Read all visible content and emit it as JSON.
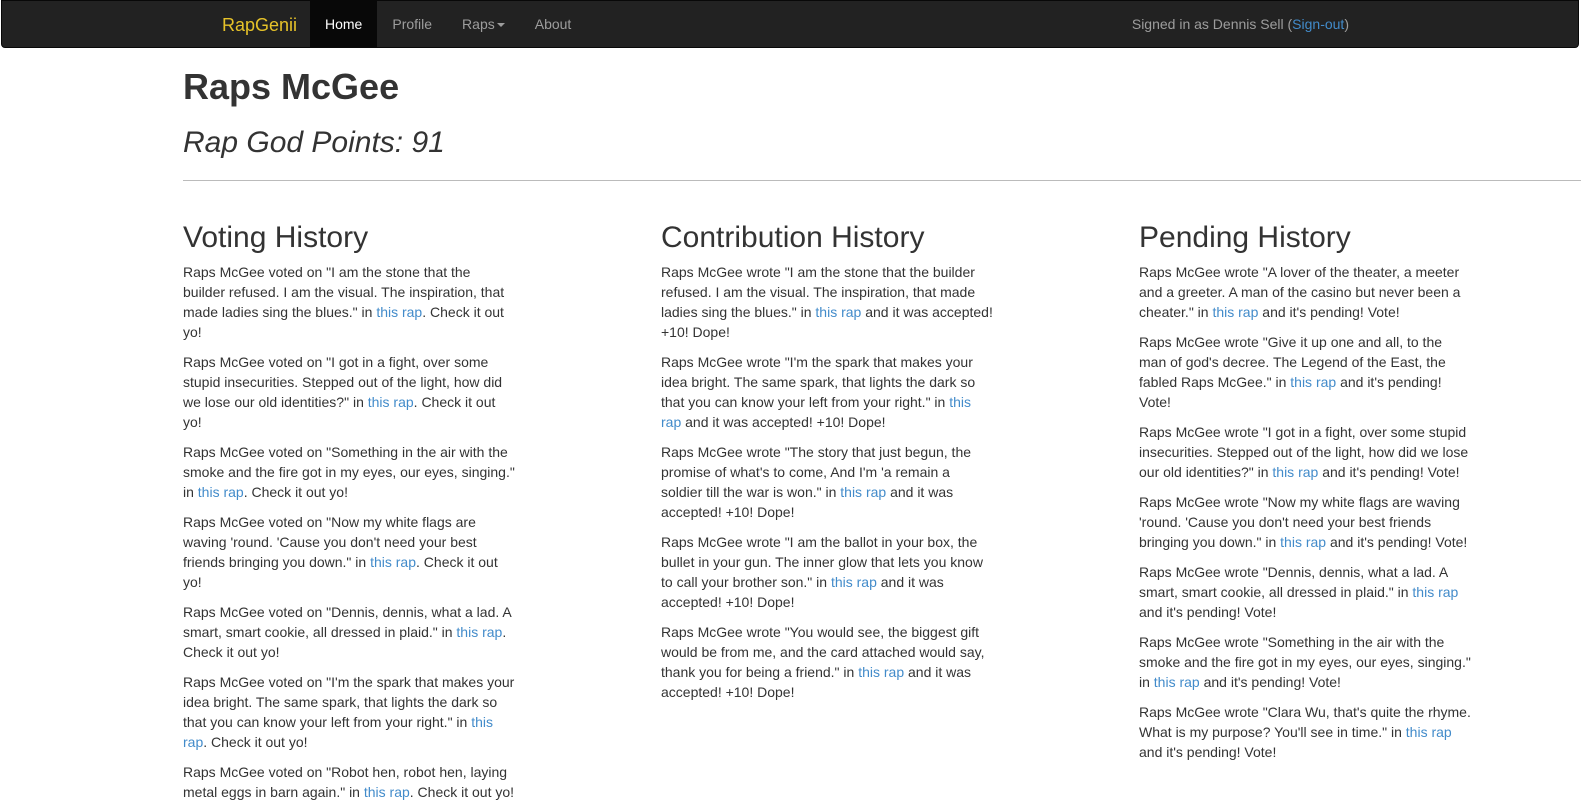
{
  "nav": {
    "brand": "RapGenii",
    "items": [
      "Home",
      "Profile",
      "Raps",
      "About"
    ],
    "signed_prefix": "Signed in as Dennis Sell (",
    "signout_label": "Sign-out",
    "signed_suffix": ")"
  },
  "profile": {
    "name": "Raps McGee",
    "points_label": "Rap God Points: 91"
  },
  "link_text": "this rap",
  "voting": {
    "title": "Voting History",
    "entries": [
      {
        "pre": "Raps McGee voted on \"I am the stone that the builder refused. I am the visual. The inspiration, that made ladies sing the blues.\" in ",
        "post": ". Check it out yo!"
      },
      {
        "pre": "Raps McGee voted on \"I got in a fight, over some stupid insecurities. Stepped out of the light, how did we lose our old identities?\" in ",
        "post": ". Check it out yo!"
      },
      {
        "pre": "Raps McGee voted on \"Something in the air with the smoke and the fire got in my eyes, our eyes, singing.\" in ",
        "post": ". Check it out yo!"
      },
      {
        "pre": "Raps McGee voted on \"Now my white flags are waving 'round. 'Cause you don't need your best friends bringing you down.\" in ",
        "post": ". Check it out yo!"
      },
      {
        "pre": "Raps McGee voted on \"Dennis, dennis, what a lad. A smart, smart cookie, all dressed in plaid.\" in ",
        "post": ". Check it out yo!"
      },
      {
        "pre": "Raps McGee voted on \"I'm the spark that makes your idea bright. The same spark, that lights the dark so that you can know your left from your right.\" in ",
        "post": ". Check it out yo!"
      },
      {
        "pre": "Raps McGee voted on \"Robot hen, robot hen, laying metal eggs in barn again.\" in ",
        "post": ". Check it out yo!"
      }
    ]
  },
  "contribution": {
    "title": "Contribution History",
    "entries": [
      {
        "pre": "Raps McGee wrote \"I am the stone that the builder refused. I am the visual. The inspiration, that made ladies sing the blues.\" in ",
        "post": " and it was accepted! +10! Dope!"
      },
      {
        "pre": "Raps McGee wrote \"I'm the spark that makes your idea bright. The same spark, that lights the dark so that you can know your left from your right.\" in ",
        "post": " and it was accepted! +10! Dope!"
      },
      {
        "pre": "Raps McGee wrote \"The story that just begun, the promise of what's to come, And I'm 'a remain a soldier till the war is won.\" in ",
        "post": " and it was accepted! +10! Dope!"
      },
      {
        "pre": "Raps McGee wrote \"I am the ballot in your box, the bullet in your gun. The inner glow that lets you know to call your brother son.\" in ",
        "post": " and it was accepted! +10! Dope!"
      },
      {
        "pre": "Raps McGee wrote \"You would see, the biggest gift would be from me, and the card attached would say, thank you for being a friend.\" in ",
        "post": " and it was accepted! +10! Dope!"
      }
    ]
  },
  "pending": {
    "title": "Pending History",
    "entries": [
      {
        "pre": "Raps McGee wrote \"A lover of the theater, a meeter and a greeter. A man of the casino but never been a cheater.\" in ",
        "post": " and it's pending! Vote!"
      },
      {
        "pre": "Raps McGee wrote \"Give it up one and all, to the man of god's decree. The Legend of the East, the fabled Raps McGee.\" in ",
        "post": " and it's pending! Vote!"
      },
      {
        "pre": "Raps McGee wrote \"I got in a fight, over some stupid insecurities. Stepped out of the light, how did we lose our old identities?\" in ",
        "post": " and it's pending! Vote!"
      },
      {
        "pre": "Raps McGee wrote \"Now my white flags are waving 'round. 'Cause you don't need your best friends bringing you down.\" in ",
        "post": " and it's pending! Vote!"
      },
      {
        "pre": "Raps McGee wrote \"Dennis, dennis, what a lad. A smart, smart cookie, all dressed in plaid.\" in ",
        "post": " and it's pending! Vote!"
      },
      {
        "pre": "Raps McGee wrote \"Something in the air with the smoke and the fire got in my eyes, our eyes, singing.\" in ",
        "post": " and it's pending! Vote!"
      },
      {
        "pre": "Raps McGee wrote \"Clara Wu, that's quite the rhyme. What is my purpose? You'll see in time.\" in ",
        "post": " and it's pending! Vote!"
      }
    ]
  }
}
